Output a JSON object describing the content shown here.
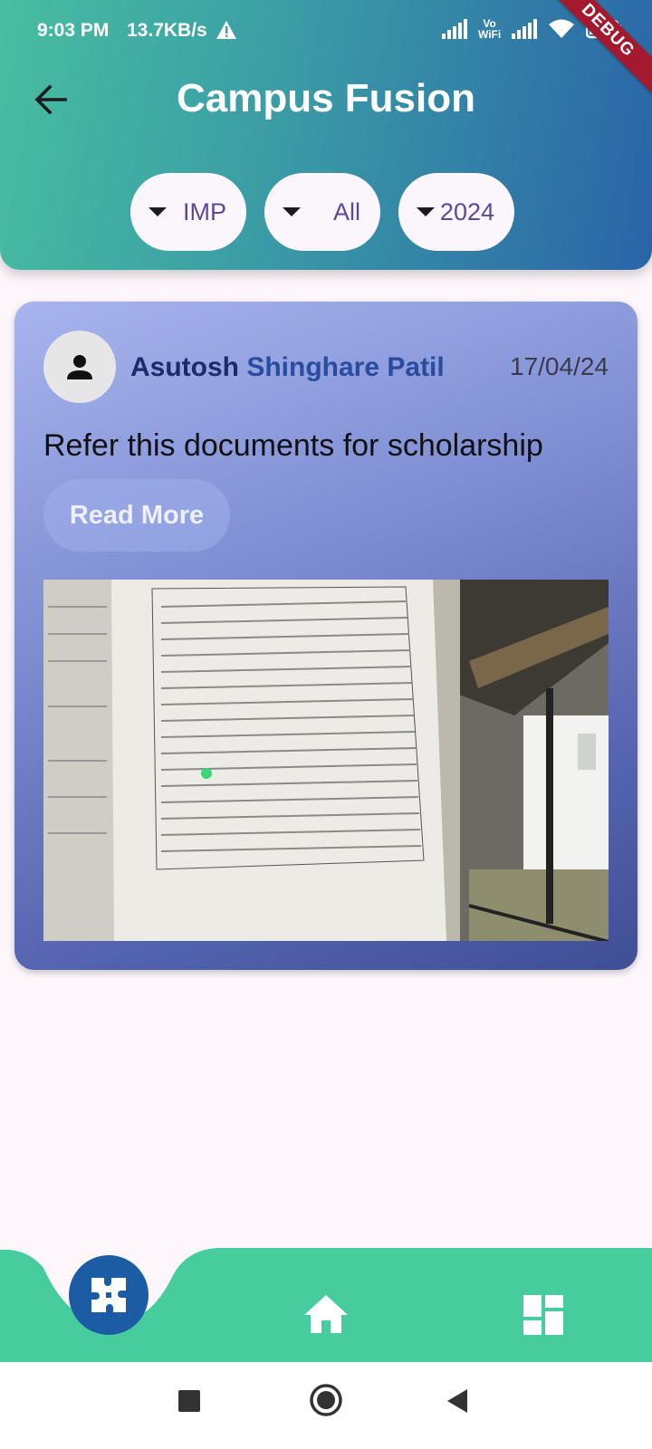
{
  "status_bar": {
    "time": "9:03 PM",
    "speed": "13.7KB/s",
    "vowifi": [
      "Vo",
      "WiFi"
    ]
  },
  "debug_banner": "DEBUG",
  "header": {
    "title": "Campus Fusion"
  },
  "filters": [
    {
      "value": "IMP"
    },
    {
      "value": "All"
    },
    {
      "value": "2024"
    }
  ],
  "post": {
    "author_first": "Asutosh",
    "author_rest": "Shinghare Patil",
    "date": "17/04/24",
    "text": "Refer this documents for scholarship",
    "read_more": "Read More"
  },
  "colors": {
    "header_start": "#48bea0",
    "header_end": "#2a64a8",
    "nav_bar": "#46cc9d",
    "fab": "#1b5ca5",
    "card_start": "#a7b4ee",
    "card_end": "#3e4f96"
  },
  "icons": {
    "back": "arrow-left-icon",
    "avatar": "person-icon",
    "fab": "puzzle-icon",
    "home": "home-icon",
    "dashboard": "dashboard-icon"
  }
}
